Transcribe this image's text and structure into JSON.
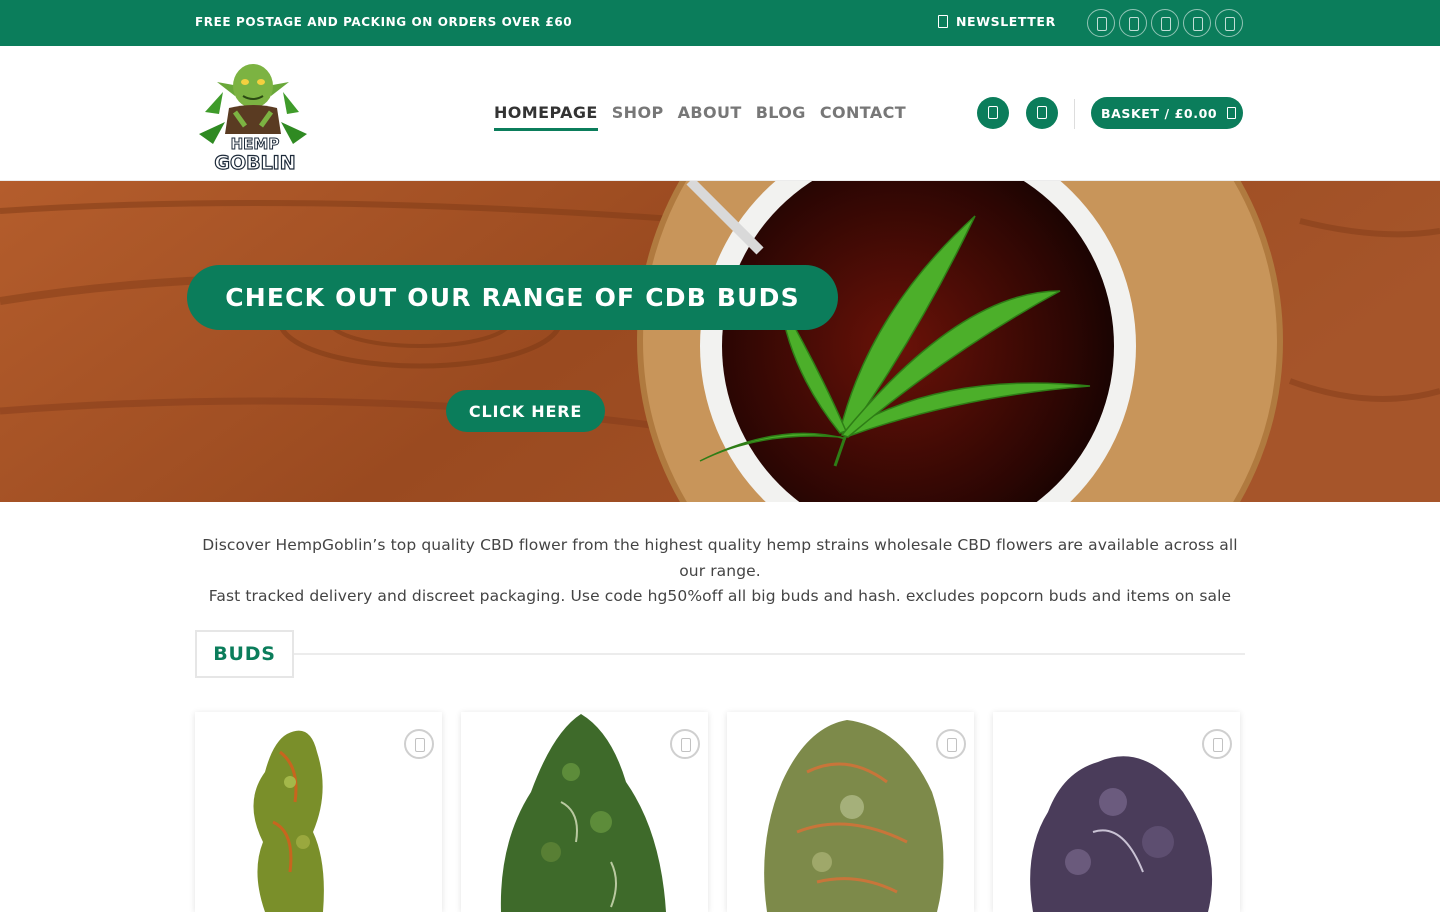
{
  "topbar": {
    "promo": "FREE POSTAGE AND PACKING ON ORDERS OVER £60",
    "newsletter_label": "NEWSLETTER",
    "social_icons": [
      "facebook-icon",
      "instagram-icon",
      "twitter-icon",
      "email-icon",
      "phone-icon"
    ]
  },
  "header": {
    "logo_text": "HEMP GOBLIN",
    "nav": [
      "HOMEPAGE",
      "SHOP",
      "ABOUT",
      "BLOG",
      "CONTACT"
    ],
    "active_nav": "HOMEPAGE",
    "basket_label": "BASKET / £0.00"
  },
  "hero": {
    "title": "CHECK OUT OUR RANGE OF CDB BUDS",
    "cta": "CLICK HERE"
  },
  "intro": {
    "line1": "Discover HempGoblin’s top quality CBD flower from the highest quality hemp strains wholesale CBD flowers are available across all our range.",
    "line2": "Fast tracked delivery and discreet packaging. Use code hg50%off all big buds and hash. excludes popcorn buds and items on sale"
  },
  "section": {
    "title": "BUDS"
  },
  "products": [
    {
      "image": "green-orange-bud"
    },
    {
      "image": "dark-green-bud"
    },
    {
      "image": "frosty-orange-bud"
    },
    {
      "image": "purple-bud"
    }
  ],
  "colors": {
    "brand_green": "#0b7d5b",
    "text": "#444444",
    "nav_inactive": "#777777"
  }
}
